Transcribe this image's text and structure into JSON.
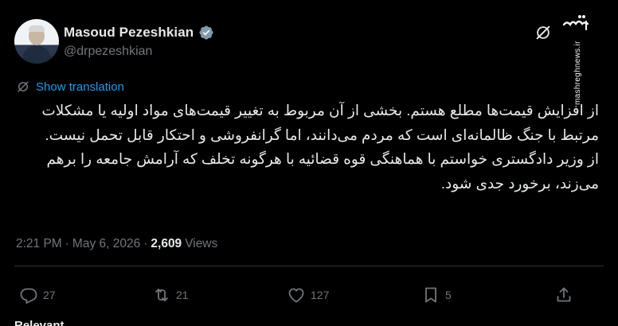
{
  "author": {
    "name": "Masoud Pezeshkian",
    "handle": "@drpezeshkian"
  },
  "watermark": {
    "site": "mashreghnews.ir",
    "logo_text": "مشرق"
  },
  "translate": {
    "label": "Show translation"
  },
  "tweet": {
    "paragraph1": "از افزایش قیمت‌ها مطلع هستم. بخشی از  آن مربوط به تغییر قیمت‌های مواد اولیه یا مشکلات مرتبط با جنگ ظالمانه‌ای است که مردم می‌دانند، اما گرانفروشی و احتکار قابل تحمل نیست.",
    "paragraph2": "از وزیر دادگستری خواستم با هماهنگی قوه قضائیه با هرگونه تخلف که آرامش جامعه را برهم می‌زند، برخورد جدی شود."
  },
  "meta": {
    "time": "2:21 PM",
    "separator1": "·",
    "date": "May 6, 2026",
    "separator2": "·",
    "views_count": "2,609",
    "views_label": "Views"
  },
  "actions": {
    "replies": "27",
    "reposts": "21",
    "likes": "127",
    "bookmarks": "5"
  },
  "footer": {
    "relevant_label": "Relevant"
  },
  "colors": {
    "background": "#000000",
    "text": "#e7e9ea",
    "muted": "#71767b",
    "link": "#1d9bf0",
    "verified": "#829aab"
  },
  "icons": [
    "verified-badge-icon",
    "grok-icon",
    "translate-icon",
    "reply-icon",
    "repost-icon",
    "like-icon",
    "bookmark-icon",
    "share-icon",
    "chevron-down-icon"
  ]
}
